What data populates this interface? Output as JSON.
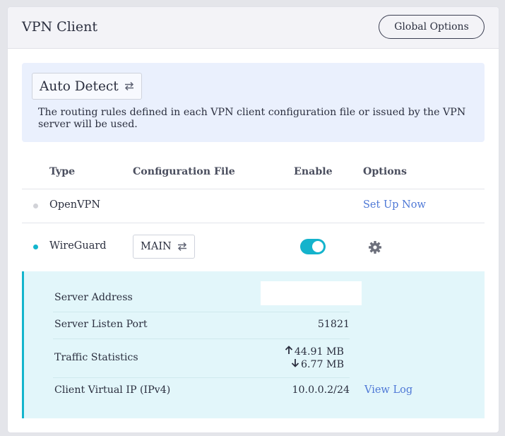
{
  "header": {
    "title": "VPN Client",
    "global_options_label": "Global Options"
  },
  "mode": {
    "selected": "Auto Detect",
    "icon": "swap-arrows-icon",
    "description": "The routing rules defined in each VPN client configuration file or issued by the VPN server will be used."
  },
  "table": {
    "columns": [
      "Type",
      "Configuration File",
      "Enable",
      "Options"
    ],
    "rows": [
      {
        "type": "OpenVPN",
        "status_color": "#d2d3d8",
        "config_file": "",
        "enabled": null,
        "options_label": "Set Up Now"
      },
      {
        "type": "WireGuard",
        "status_color": "#13b5cd",
        "config_file": "MAIN",
        "enabled": true,
        "options_icon": "gear-icon"
      }
    ]
  },
  "details": {
    "server_address_label": "Server Address",
    "server_address_value": "",
    "listen_port_label": "Server Listen Port",
    "listen_port_value": "51821",
    "traffic_label": "Traffic Statistics",
    "traffic_up": "44.91 MB",
    "traffic_down": "6.77 MB",
    "virtual_ip_label": "Client Virtual IP (IPv4)",
    "virtual_ip_value": "10.0.0.2/24",
    "view_log_label": "View Log"
  },
  "colors": {
    "accent": "#13b5cd",
    "link": "#4e78d6",
    "mode_bg": "#eaf0fd",
    "details_bg": "#e2f6fa"
  }
}
